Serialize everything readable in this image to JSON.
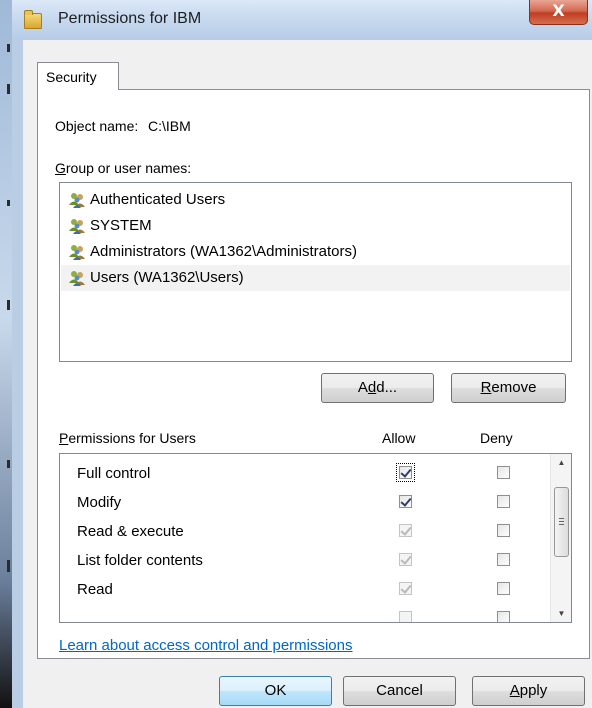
{
  "window": {
    "title": "Permissions for IBM",
    "close_glyph": "X"
  },
  "tab": {
    "label": "Security"
  },
  "object": {
    "label": "Object name:",
    "value": "C:\\IBM"
  },
  "groups": {
    "label_prefix": "",
    "label_ul": "G",
    "label_rest": "roup or user names:",
    "items": [
      {
        "label": "Authenticated Users",
        "icon": "users-group-icon"
      },
      {
        "label": "SYSTEM",
        "icon": "users-group-icon"
      },
      {
        "label": "Administrators (WA1362\\Administrators)",
        "icon": "users-group-icon"
      },
      {
        "label": "Users (WA1362\\Users)",
        "icon": "users-group-icon",
        "selected": true
      }
    ],
    "add_button": {
      "pre": "A",
      "ul": "d",
      "post": "d..."
    },
    "remove_button": {
      "pre": "",
      "ul": "R",
      "post": "emove"
    }
  },
  "permissions": {
    "label_pre": "",
    "label_ul": "P",
    "label_rest": "ermissions for Users",
    "allow_header": "Allow",
    "deny_header": "Deny",
    "rows": [
      {
        "name": "Full control",
        "allow": true,
        "allow_disabled": false,
        "deny": false
      },
      {
        "name": "Modify",
        "allow": true,
        "allow_disabled": false,
        "deny": false
      },
      {
        "name": "Read & execute",
        "allow": true,
        "allow_disabled": true,
        "deny": false
      },
      {
        "name": "List folder contents",
        "allow": true,
        "allow_disabled": true,
        "deny": false
      },
      {
        "name": "Read",
        "allow": true,
        "allow_disabled": true,
        "deny": false
      }
    ]
  },
  "help_link": "Learn about access control and permissions",
  "footer": {
    "ok": "OK",
    "cancel": "Cancel",
    "apply": {
      "pre": "",
      "ul": "A",
      "post": "pply"
    }
  }
}
